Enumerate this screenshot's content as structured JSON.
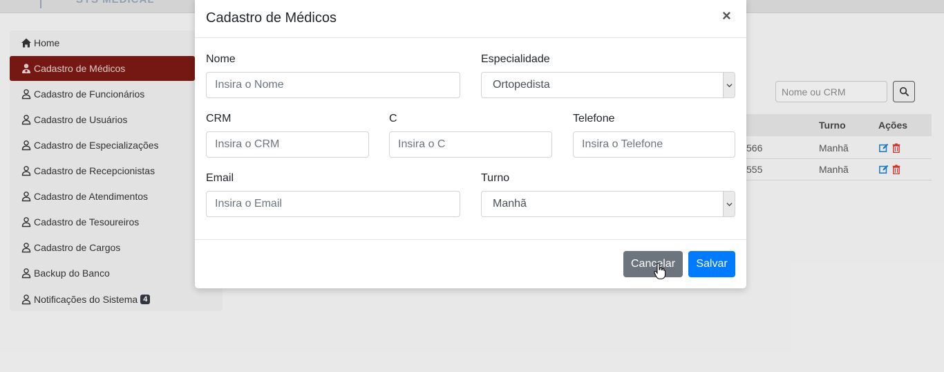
{
  "app": {
    "brand": "SYS MEDICAL"
  },
  "sidebar": {
    "items": [
      {
        "label": "Home",
        "icon": "home-icon",
        "active": false
      },
      {
        "label": "Cadastro de Médicos",
        "icon": "user-doctor-icon",
        "active": true
      },
      {
        "label": "Cadastro de Funcionários",
        "icon": "user-icon",
        "active": false
      },
      {
        "label": "Cadastro de Usuários",
        "icon": "user-icon",
        "active": false
      },
      {
        "label": "Cadastro de Especializações",
        "icon": "user-icon",
        "active": false
      },
      {
        "label": "Cadastro de Recepcionistas",
        "icon": "user-icon",
        "active": false
      },
      {
        "label": "Cadastro de Atendimentos",
        "icon": "user-icon",
        "active": false
      },
      {
        "label": "Cadastro de Tesoureiros",
        "icon": "user-icon",
        "active": false
      },
      {
        "label": "Cadastro de Cargos",
        "icon": "user-icon",
        "active": false
      },
      {
        "label": "Backup do Banco",
        "icon": "user-icon",
        "active": false
      },
      {
        "label": "Notificações do Sistema",
        "icon": "user-icon",
        "active": false,
        "badge": "4"
      }
    ]
  },
  "search": {
    "placeholder": "Nome ou CRM",
    "button_icon": "search-icon"
  },
  "table": {
    "headers": {
      "turno": "Turno",
      "acoes": "Ações"
    },
    "rows": [
      {
        "partial": "566",
        "turno": "Manhã"
      },
      {
        "partial": "555",
        "turno": "Manhã"
      }
    ],
    "row_icons": [
      "edit-icon",
      "trash-icon"
    ]
  },
  "modal": {
    "title": "Cadastro de Médicos",
    "close_label": "×",
    "fields": {
      "nome": {
        "label": "Nome",
        "placeholder": "Insira o Nome"
      },
      "especialidade": {
        "label": "Especialidade",
        "value": "Ortopedista"
      },
      "crm": {
        "label": "CRM",
        "placeholder": "Insira o CRM"
      },
      "cpf": {
        "label": "C",
        "placeholder": "Insira o C"
      },
      "telefone": {
        "label": "Telefone",
        "placeholder": "Insira o Telefone"
      },
      "email": {
        "label": "Email",
        "placeholder": "Insira o Email"
      },
      "turno": {
        "label": "Turno",
        "value": "Manhã"
      }
    },
    "buttons": {
      "cancel": "Cancelar",
      "save": "Salvar"
    }
  },
  "colors": {
    "active_sidebar": "#7a1a14",
    "primary": "#007bff",
    "secondary": "#6c757d",
    "edit_icon": "#1f7fc9",
    "trash_icon": "#d9342b"
  }
}
